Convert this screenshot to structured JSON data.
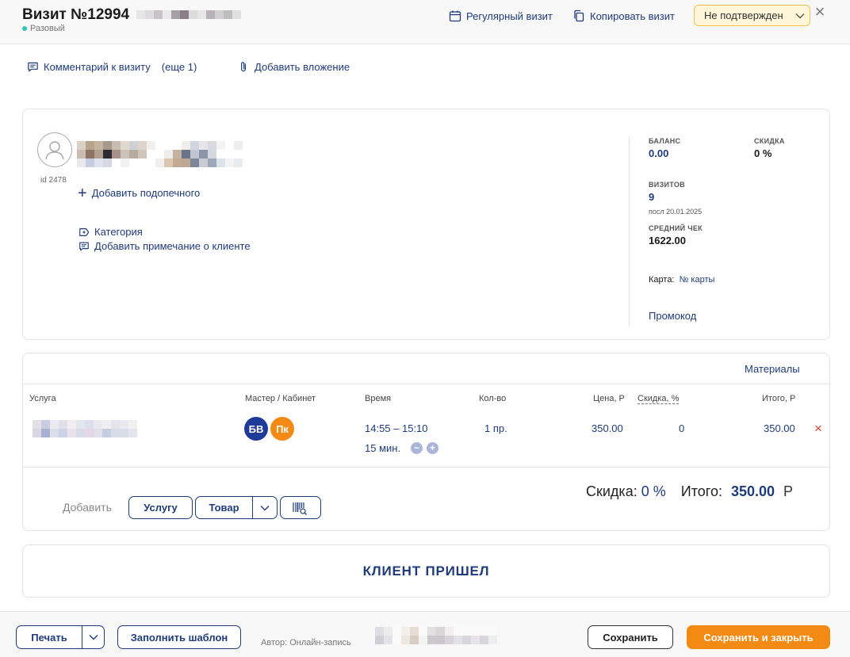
{
  "header": {
    "title": "Визит №12994",
    "visit_type": "Разовый",
    "regular_visit": "Регулярный визит",
    "copy_visit": "Копировать визит",
    "status": "Не подтвержден"
  },
  "toolbar": {
    "comment": "Комментарий к визиту",
    "comment_more": "(еще 1)",
    "attachment": "Добавить вложение"
  },
  "client": {
    "id_label": "id 2478",
    "add_ward": "Добавить подопечного",
    "category": "Категория",
    "add_note": "Добавить примечание о клиенте"
  },
  "stats": {
    "balance_label": "БАЛАНС",
    "balance": "0.00",
    "discount_label": "СКИДКА",
    "discount": "0 %",
    "visits_label": "ВИЗИТОВ",
    "visits": "9",
    "last_visit": "посл 20.01.2025",
    "avg_check_label": "СРЕДНИЙ ЧЕК",
    "avg_check": "1622.00",
    "card_label": "Карта:",
    "card_link": "№ карты",
    "promo": "Промокод"
  },
  "services": {
    "materials": "Материалы",
    "columns": {
      "service": "Услуга",
      "master": "Мастер / Кабинет",
      "time": "Время",
      "qty": "Кол-во",
      "price": "Цена, Р",
      "discount": "Скидка, %",
      "total": "Итого, Р"
    },
    "row": {
      "master_initials": "БВ",
      "cabinet_initials": "Пк",
      "time": "14:55 – 15:10",
      "duration": "15 мин.",
      "qty": "1 пр.",
      "price": "350.00",
      "discount": "0",
      "total": "350.00"
    },
    "add_label": "Добавить",
    "add_service": "Услугу",
    "add_product": "Товар",
    "summary_discount_label": "Скидка:",
    "summary_discount": "0 %",
    "summary_total_label": "Итого:",
    "summary_total": "350.00",
    "currency": "Р"
  },
  "client_arrived": "КЛИЕНТ ПРИШЕЛ",
  "footer": {
    "print": "Печать",
    "fill_template": "Заполнить шаблон",
    "author": "Автор: Онлайн-запись",
    "save": "Сохранить",
    "save_close": "Сохранить и закрыть"
  },
  "colors": {
    "accent": "#1f3b7a",
    "orange": "#f28a13",
    "status_bg": "#fff6d9",
    "status_border": "#f2c04a",
    "delete": "#e0403a",
    "master_badge": "#1f3b9a",
    "cabinet_badge": "#f28a13"
  }
}
